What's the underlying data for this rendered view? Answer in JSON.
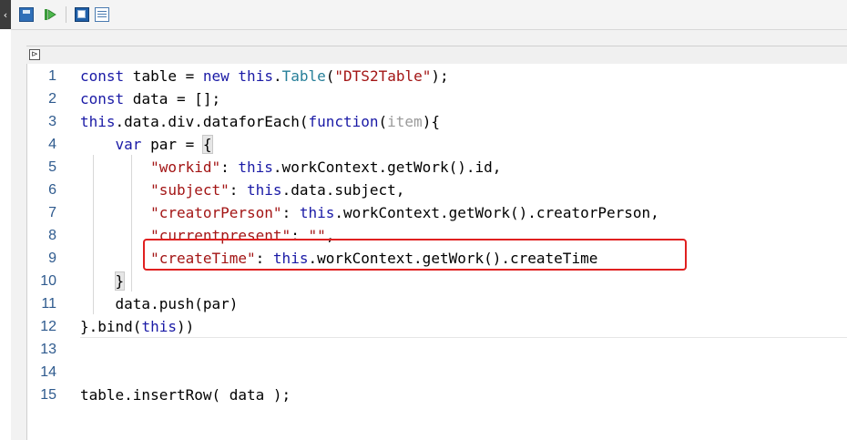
{
  "toolbar": {
    "buttons": [
      {
        "icon": "save-icon"
      },
      {
        "icon": "run-icon"
      },
      {
        "icon": "save-as-icon"
      },
      {
        "icon": "list-icon"
      }
    ]
  },
  "panel": {
    "expand_glyph": "⊳"
  },
  "editor": {
    "lines": [
      {
        "num": "1",
        "tokens": [
          {
            "t": "kw",
            "v": "const"
          },
          {
            "t": "plain",
            "v": " table = "
          },
          {
            "t": "kw",
            "v": "new"
          },
          {
            "t": "plain",
            "v": " "
          },
          {
            "t": "kw",
            "v": "this"
          },
          {
            "t": "plain",
            "v": "."
          },
          {
            "t": "fn",
            "v": "Table"
          },
          {
            "t": "plain",
            "v": "("
          },
          {
            "t": "str",
            "v": "\"DTS2Table\""
          },
          {
            "t": "plain",
            "v": ");"
          }
        ]
      },
      {
        "num": "2",
        "tokens": [
          {
            "t": "kw",
            "v": "const"
          },
          {
            "t": "plain",
            "v": " data = [];"
          }
        ]
      },
      {
        "num": "3",
        "tokens": [
          {
            "t": "kw",
            "v": "this"
          },
          {
            "t": "plain",
            "v": ".data.div.dataforEach("
          },
          {
            "t": "kw",
            "v": "function"
          },
          {
            "t": "plain",
            "v": "("
          },
          {
            "t": "param",
            "v": "item"
          },
          {
            "t": "plain",
            "v": "){"
          }
        ]
      },
      {
        "num": "4",
        "tokens": [
          {
            "t": "plain",
            "v": "    "
          },
          {
            "t": "kw",
            "v": "var"
          },
          {
            "t": "plain",
            "v": " par = "
          },
          {
            "t": "brk",
            "v": "{"
          }
        ]
      },
      {
        "num": "5",
        "tokens": [
          {
            "t": "plain",
            "v": "        "
          },
          {
            "t": "str",
            "v": "\"workid\""
          },
          {
            "t": "plain",
            "v": ": "
          },
          {
            "t": "kw",
            "v": "this"
          },
          {
            "t": "plain",
            "v": ".workContext.getWork().id,"
          }
        ]
      },
      {
        "num": "6",
        "tokens": [
          {
            "t": "plain",
            "v": "        "
          },
          {
            "t": "str",
            "v": "\"subject\""
          },
          {
            "t": "plain",
            "v": ": "
          },
          {
            "t": "kw",
            "v": "this"
          },
          {
            "t": "plain",
            "v": ".data.subject,"
          }
        ]
      },
      {
        "num": "7",
        "tokens": [
          {
            "t": "plain",
            "v": "        "
          },
          {
            "t": "str",
            "v": "\"creatorPerson\""
          },
          {
            "t": "plain",
            "v": ": "
          },
          {
            "t": "kw",
            "v": "this"
          },
          {
            "t": "plain",
            "v": ".workContext.getWork().creatorPerson,"
          }
        ]
      },
      {
        "num": "8",
        "tokens": [
          {
            "t": "plain",
            "v": "        "
          },
          {
            "t": "str",
            "v": "\"currentpresent\""
          },
          {
            "t": "plain",
            "v": ": "
          },
          {
            "t": "str",
            "v": "\"\""
          },
          {
            "t": "plain",
            "v": ","
          }
        ]
      },
      {
        "num": "9",
        "tokens": [
          {
            "t": "plain",
            "v": "        "
          },
          {
            "t": "str",
            "v": "\"createTime\""
          },
          {
            "t": "plain",
            "v": ": "
          },
          {
            "t": "kw",
            "v": "this"
          },
          {
            "t": "plain",
            "v": ".workContext.getWork().createTime"
          }
        ]
      },
      {
        "num": "10",
        "tokens": [
          {
            "t": "plain",
            "v": "    "
          },
          {
            "t": "brk",
            "v": "}"
          }
        ]
      },
      {
        "num": "11",
        "tokens": [
          {
            "t": "plain",
            "v": "    data.push(par)"
          }
        ]
      },
      {
        "num": "12",
        "tokens": [
          {
            "t": "plain",
            "v": "}.bind("
          },
          {
            "t": "kw",
            "v": "this"
          },
          {
            "t": "plain",
            "v": "))"
          }
        ]
      },
      {
        "num": "13",
        "tokens": []
      },
      {
        "num": "14",
        "tokens": []
      },
      {
        "num": "15",
        "tokens": [
          {
            "t": "plain",
            "v": "table.insertRow( data );"
          }
        ]
      }
    ]
  },
  "colors": {
    "keyword": "#1a1aa6",
    "string": "#a31515",
    "function": "#267f99",
    "line_number": "#2e5a8e",
    "highlight_box": "#e02020"
  }
}
